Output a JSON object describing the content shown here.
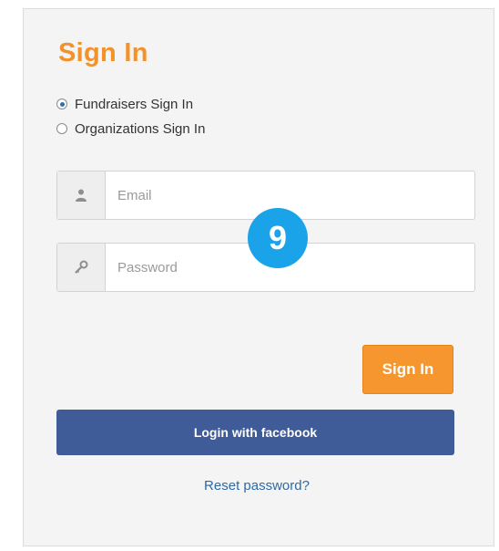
{
  "title": "Sign In",
  "radios": [
    {
      "label": "Fundraisers Sign In",
      "selected": true
    },
    {
      "label": "Organizations Sign In",
      "selected": false
    }
  ],
  "email": {
    "placeholder": "Email",
    "icon": "user-icon"
  },
  "password": {
    "placeholder": "Password",
    "icon": "key-icon"
  },
  "badge": "9",
  "signin_label": "Sign In",
  "facebook_label": "Login with facebook",
  "reset_label": "Reset password?",
  "colors": {
    "accent": "#f3922a",
    "facebook": "#3f5b98",
    "link": "#2e6aa6",
    "badge": "#1aa3e8"
  }
}
